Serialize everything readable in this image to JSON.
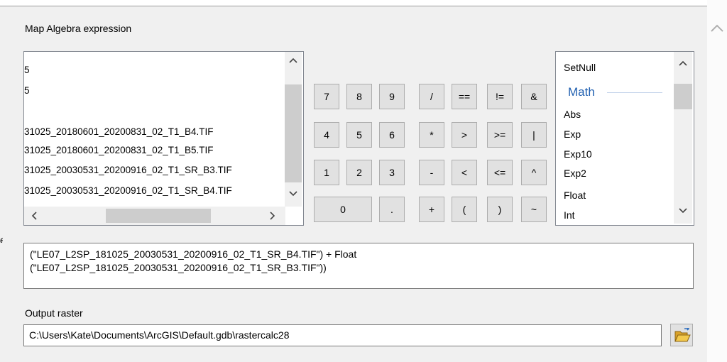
{
  "header": {
    "expression_label": "Map Algebra expression"
  },
  "layers": [
    "5",
    "5",
    "",
    "31025_20180601_20200831_02_T1_B4.TIF",
    "31025_20180601_20200831_02_T1_B5.TIF",
    "31025_20030531_20200916_02_T1_SR_B3.TIF",
    "31025_20030531_20200916_02_T1_SR_B4.TIF"
  ],
  "keypad": {
    "row1": [
      "7",
      "8",
      "9",
      "/",
      "==",
      "!=",
      "&"
    ],
    "row2": [
      "4",
      "5",
      "6",
      "*",
      ">",
      ">=",
      "|"
    ],
    "row3": [
      "1",
      "2",
      "3",
      "-",
      "<",
      "<=",
      "^"
    ],
    "row4": [
      "0",
      ".",
      "+",
      "(",
      ")",
      "~"
    ]
  },
  "functions": {
    "set_null": "SetNull",
    "group": "Math",
    "items": [
      "Abs",
      "Exp",
      "Exp10",
      "Exp2",
      "Float",
      "Int"
    ]
  },
  "expression": {
    "line1": "(\"LE07_L2SP_181025_20030531_20200916_02_T1_SR_B4.TIF\") + Float",
    "line2": "(\"LE07_L2SP_181025_20030531_20200916_02_T1_SR_B3.TIF\"))"
  },
  "output": {
    "label": "Output raster",
    "value": "C:\\Users\\Kate\\Documents\\ArcGIS\\Default.gdb\\rastercalc28"
  },
  "icons": {
    "scroll_up": "chevron-up-icon",
    "scroll_down": "chevron-down-icon",
    "scroll_left": "chevron-left-icon",
    "scroll_right": "chevron-right-icon",
    "browse": "folder-open-icon"
  },
  "colors": {
    "math_group": "#1f5fb0",
    "folder": "#e8b93a"
  }
}
